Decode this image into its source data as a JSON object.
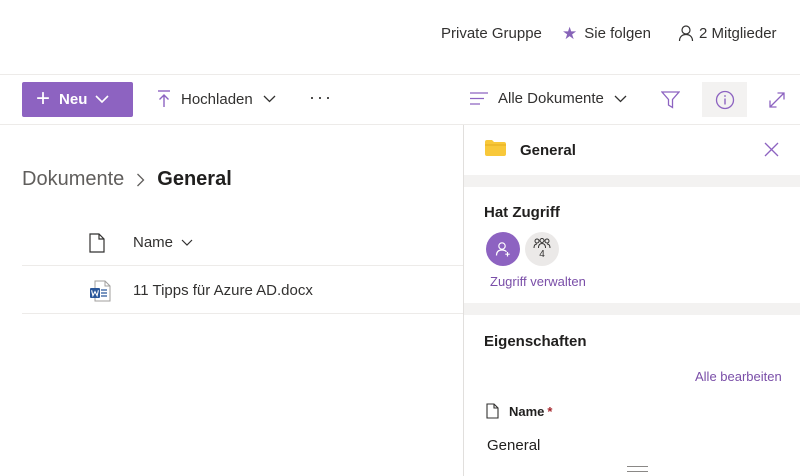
{
  "header": {
    "group_type": "Private Gruppe",
    "follow_label": "Sie folgen",
    "members_label": "2 Mitglieder"
  },
  "commandbar": {
    "new_label": "Neu",
    "upload_label": "Hochladen",
    "more_label": "···",
    "view_label": "Alle Dokumente"
  },
  "breadcrumb": {
    "root": "Dokumente",
    "current": "General"
  },
  "list": {
    "column_name": "Name",
    "rows": [
      {
        "name": "11 Tipps für Azure AD.docx",
        "type": "word"
      }
    ]
  },
  "panel": {
    "title": "General",
    "access": {
      "title": "Hat Zugriff",
      "count": "4",
      "manage_label": "Zugriff verwalten"
    },
    "properties": {
      "title": "Eigenschaften",
      "edit_all_label": "Alle bearbeiten",
      "name_label": "Name",
      "required_mark": "*",
      "name_value": "General"
    }
  },
  "colors": {
    "accent": "#8d63c1",
    "link": "#7a4ea8",
    "folder": "#f8c83a",
    "word_blue": "#2b579a"
  }
}
